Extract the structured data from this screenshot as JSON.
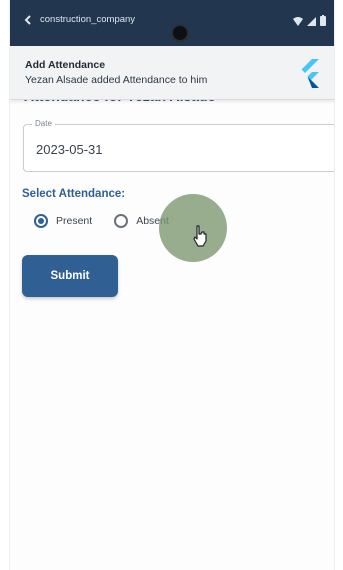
{
  "status_bar": {
    "app_name": "construction_company",
    "icons": [
      "wifi-icon",
      "signal-icon",
      "battery-icon"
    ]
  },
  "notification": {
    "title": "Add Attendance",
    "body": "Yezan Alsade added Attendance to him",
    "icon": "flutter-logo-icon"
  },
  "page": {
    "title": "Attendance for Yezan Alsade"
  },
  "form": {
    "date_label": "Date",
    "date_value": "2023-05-31",
    "select_label": "Select Attendance:",
    "options": [
      {
        "label": "Present",
        "selected": true
      },
      {
        "label": "Absent",
        "selected": false
      }
    ],
    "submit_label": "Submit"
  },
  "colors": {
    "status_bar": "#22364f",
    "accent": "#2f5f93",
    "touch_indicator": "#7a966e"
  }
}
